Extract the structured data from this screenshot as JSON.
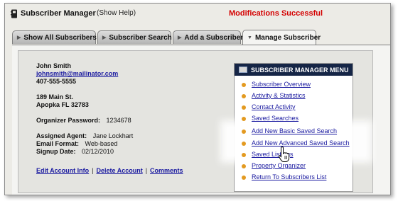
{
  "header": {
    "title": "Subscriber Manager",
    "help_link": "(Show Help)",
    "status": "Modifications Successful"
  },
  "tabs": [
    {
      "label": "Show All Subscribers",
      "active": false
    },
    {
      "label": "Subscriber Search",
      "active": false
    },
    {
      "label": "Add a Subscriber",
      "active": false
    },
    {
      "label": "Manage Subscriber",
      "active": true
    }
  ],
  "subscriber": {
    "name": "John Smith",
    "email": "johnsmith@mailinator.com",
    "phone": "407-555-5555",
    "street": "189 Main St.",
    "city_line": "Apopka FL 32783",
    "password_label": "Organizer Password:",
    "password": "1234678",
    "agent_label": "Assigned Agent:",
    "agent": "Jane Lockhart",
    "format_label": "Email Format:",
    "format": "Web-based",
    "signup_label": "Signup Date:",
    "signup": "02/12/2010"
  },
  "actions": {
    "edit": "Edit Account Info",
    "delete": "Delete Account",
    "comments": "Comments",
    "separator": "|"
  },
  "menu": {
    "title": "SUBSCRIBER MANAGER MENU",
    "items": [
      "Subscriber Overview",
      "Activity & Statistics",
      "Contact Activity",
      "Saved Searches",
      "Add New Basic Saved Search",
      "Add New Advanced Saved Search",
      "Saved Listings",
      "Property Organizer",
      "Return To Subscribers List"
    ],
    "highlighted": [
      4,
      5
    ]
  },
  "colors": {
    "status": "#d40000",
    "link": "#1a1aa0",
    "menu_header": "#152546",
    "bullet": "#e39a20"
  },
  "icons": {
    "app": "phone-book-icon",
    "tab": "triangle-right-icon",
    "active_tab": "triangle-down-icon",
    "menu": "window-icon",
    "cursor": "hand-pointer-icon"
  }
}
